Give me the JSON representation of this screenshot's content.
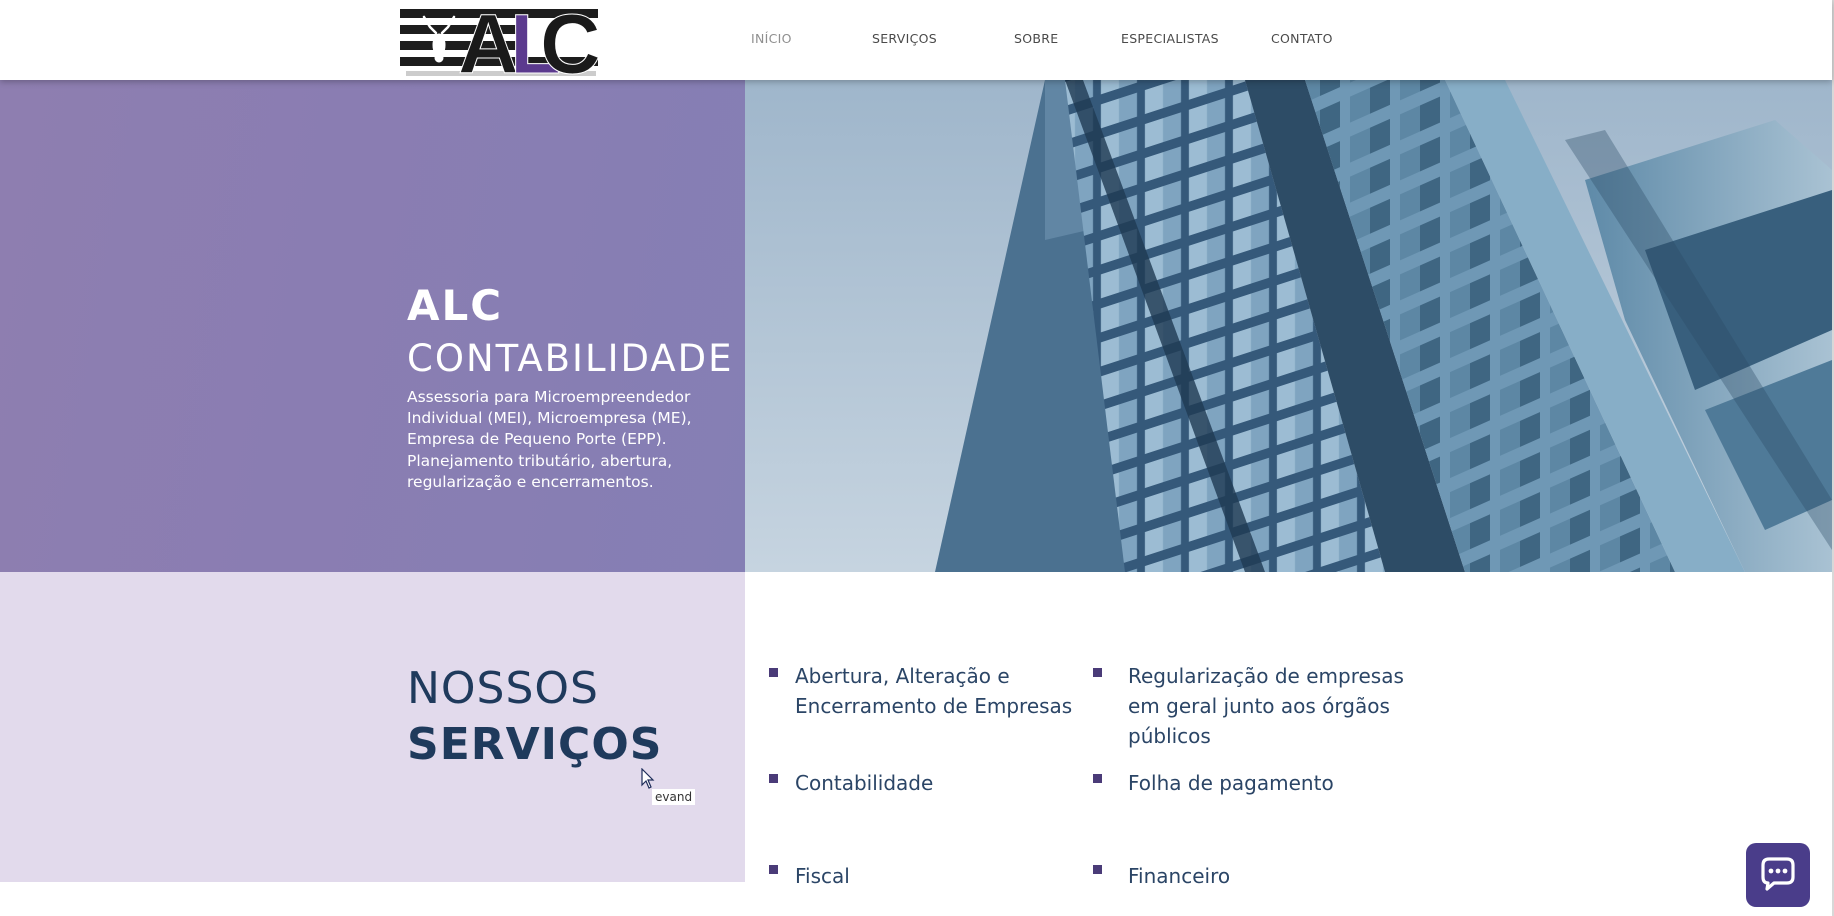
{
  "logo": {
    "text": "ALC",
    "letter_a": "A",
    "letter_l": "L",
    "letter_c": "C"
  },
  "nav": {
    "items": [
      {
        "label": "INÍCIO",
        "active": true
      },
      {
        "label": "SERVIÇOS"
      },
      {
        "label": "SOBRE"
      },
      {
        "label": "ESPECIALISTAS"
      },
      {
        "label": "CONTATO"
      }
    ]
  },
  "hero": {
    "title_line1": "ALC",
    "title_line2": "CONTABILIDADE",
    "description": "Assessoria para Microempreendedor Individual (MEI), Microempresa (ME), Empresa de Pequeno Porte (EPP). Planejamento tributário, abertura, regularização e encerramentos."
  },
  "services": {
    "heading_line1": "NOSSOS",
    "heading_line2": "SERVIÇOS",
    "items": [
      "Abertura, Alteração e Encerramento de Empresas",
      "Regularização de empresas em geral junto aos órgãos públicos",
      "Contabilidade",
      "Folha de pagamento",
      "Fiscal",
      "Financeiro"
    ]
  },
  "tooltip": {
    "text": "evand"
  },
  "colors": {
    "hero_purple": "#8a7db2",
    "services_bg": "#e2daec",
    "heading_navy": "#1f3a5c",
    "bullet": "#4a3b78",
    "chat_button": "#4a3d8a"
  },
  "icons": {
    "chat": "chat-bubble-icon",
    "cursor": "mouse-pointer-icon",
    "logo_mark": "deer-icon"
  }
}
